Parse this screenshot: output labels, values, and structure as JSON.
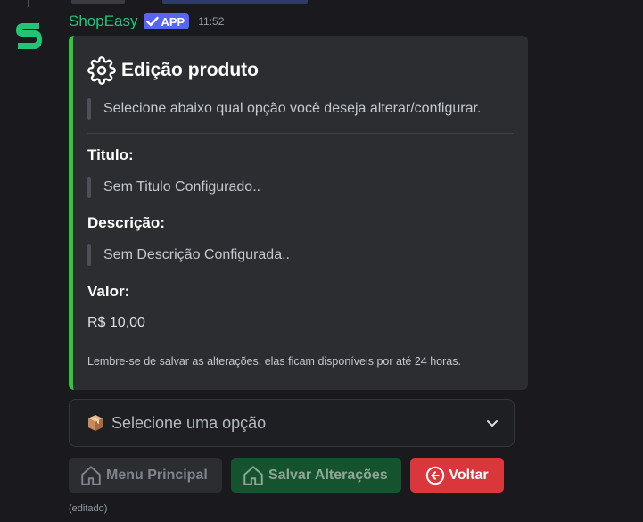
{
  "message": {
    "username": "ShopEasy",
    "badge": "APP",
    "timestamp": "11:52",
    "edited": "(editado)"
  },
  "embed": {
    "title": "Edição produto",
    "description": "Selecione abaixo qual opção você deseja alterar/configurar.",
    "fields": [
      {
        "name": "Titulo:",
        "value": "Sem Titulo Configurado.."
      },
      {
        "name": "Descrição:",
        "value": "Sem Descrição Configurada.."
      },
      {
        "name": "Valor:",
        "value": "R$ 10,00"
      }
    ],
    "footer": "Lembre-se de salvar as alterações, elas ficam disponíveis por até 24 horas."
  },
  "select": {
    "placeholder": "Selecione uma opção"
  },
  "buttons": {
    "menu": "Menu Principal",
    "save": "Salvar Alterações",
    "back": "Voltar"
  },
  "colors": {
    "accent_green": "#2ec63c",
    "username_green": "#23c478",
    "badge_blurple": "#5865f2",
    "danger_red": "#da373c"
  },
  "icons": {
    "avatar": "shopeasy-logo-icon",
    "title": "gear-icon",
    "select": "package-icon",
    "menu": "home-icon",
    "save": "home-icon",
    "back": "arrow-left-circle-icon",
    "dropdown": "chevron-down-icon"
  }
}
